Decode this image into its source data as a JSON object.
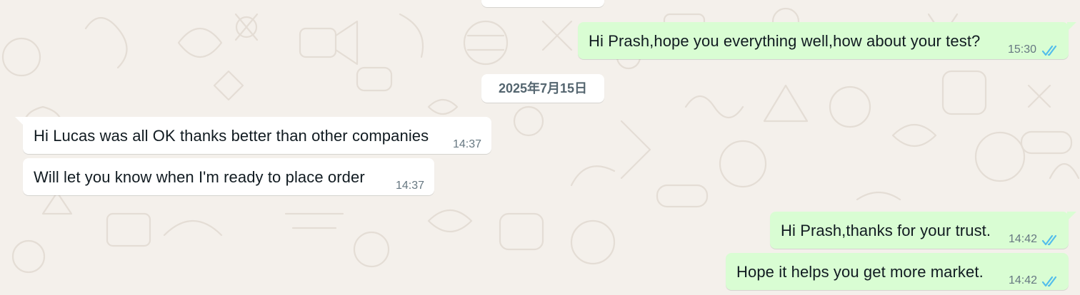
{
  "chat": {
    "date_separator": "2025年7月15日",
    "messages": [
      {
        "direction": "outgoing",
        "text": "Hi Prash,hope you everything well,how about your test?",
        "time": "15:30",
        "status": "read-ticks-icon"
      },
      {
        "direction": "incoming",
        "text": "Hi Lucas was all OK thanks better than other companies",
        "time": "14:37"
      },
      {
        "direction": "incoming",
        "text": "Will let you know when I'm ready to place order",
        "time": "14:37"
      },
      {
        "direction": "outgoing",
        "text": "Hi Prash,thanks for your trust.",
        "time": "14:42",
        "status": "read-ticks-icon"
      },
      {
        "direction": "outgoing",
        "text": "Hope it helps you get more market.",
        "time": "14:42",
        "status": "read-ticks-icon"
      }
    ]
  },
  "colors": {
    "background": "#f4f0eb",
    "incoming_bubble": "#ffffff",
    "outgoing_bubble": "#d9fdd3",
    "read_ticks": "#53bdeb",
    "time_text": "#667781"
  }
}
